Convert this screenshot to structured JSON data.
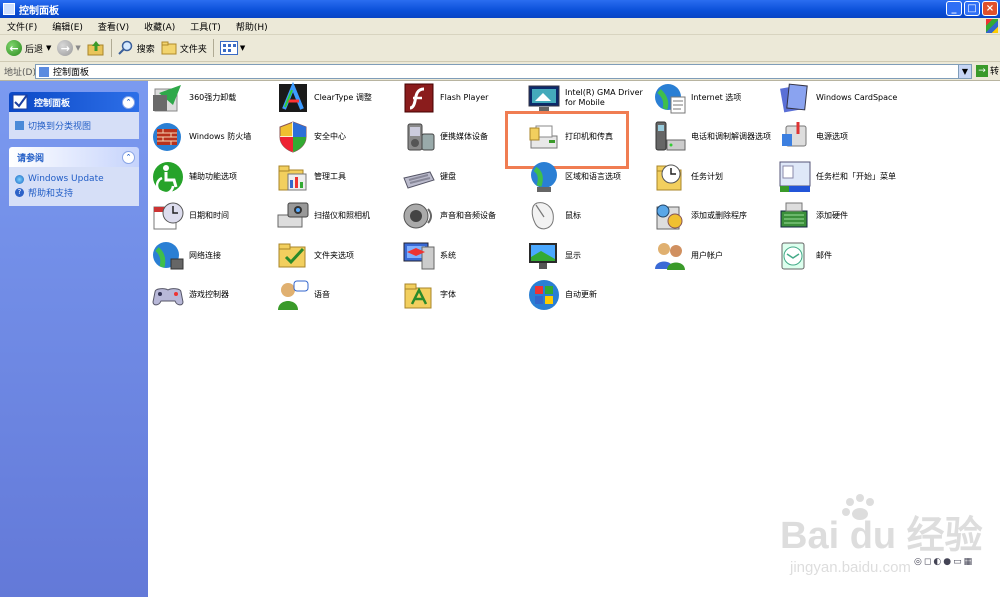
{
  "window": {
    "title": "控制面板"
  },
  "menu": [
    "文件(F)",
    "编辑(E)",
    "查看(V)",
    "收藏(A)",
    "工具(T)",
    "帮助(H)"
  ],
  "toolbar": {
    "back": "后退",
    "search": "搜索",
    "folders": "文件夹"
  },
  "address": {
    "label": "地址(D)",
    "value": "控制面板",
    "go": "转"
  },
  "sidebar": {
    "panel1": {
      "title": "控制面板",
      "link": "切换到分类视图"
    },
    "panel2": {
      "title": "请参阅",
      "links": [
        "Windows Update",
        "帮助和支持"
      ]
    }
  },
  "items": [
    {
      "label": "360强力卸载",
      "icon": "360-uninstall-icon"
    },
    {
      "label": "ClearType 调整",
      "icon": "cleartype-icon"
    },
    {
      "label": "Flash Player",
      "icon": "flash-icon"
    },
    {
      "label": "Intel(R) GMA Driver for Mobile",
      "icon": "intel-gma-icon"
    },
    {
      "label": "Internet 选项",
      "icon": "internet-options-icon"
    },
    {
      "label": "Windows CardSpace",
      "icon": "cardspace-icon"
    },
    {
      "label": "Windows 防火墙",
      "icon": "firewall-icon"
    },
    {
      "label": "安全中心",
      "icon": "security-center-icon"
    },
    {
      "label": "便携媒体设备",
      "icon": "portable-media-icon"
    },
    {
      "label": "打印机和传真",
      "icon": "printer-fax-icon"
    },
    {
      "label": "电话和调制解调器选项",
      "icon": "phone-modem-icon"
    },
    {
      "label": "电源选项",
      "icon": "power-options-icon"
    },
    {
      "label": "辅助功能选项",
      "icon": "accessibility-icon"
    },
    {
      "label": "管理工具",
      "icon": "admin-tools-icon"
    },
    {
      "label": "键盘",
      "icon": "keyboard-icon"
    },
    {
      "label": "区域和语言选项",
      "icon": "region-language-icon"
    },
    {
      "label": "任务计划",
      "icon": "scheduled-tasks-icon"
    },
    {
      "label": "任务栏和「开始」菜单",
      "icon": "taskbar-start-icon"
    },
    {
      "label": "日期和时间",
      "icon": "date-time-icon"
    },
    {
      "label": "扫描仪和照相机",
      "icon": "scanner-camera-icon"
    },
    {
      "label": "声音和音频设备",
      "icon": "sound-audio-icon"
    },
    {
      "label": "鼠标",
      "icon": "mouse-icon"
    },
    {
      "label": "添加或删除程序",
      "icon": "add-remove-programs-icon"
    },
    {
      "label": "添加硬件",
      "icon": "add-hardware-icon"
    },
    {
      "label": "网络连接",
      "icon": "network-connections-icon"
    },
    {
      "label": "文件夹选项",
      "icon": "folder-options-icon"
    },
    {
      "label": "系统",
      "icon": "system-icon"
    },
    {
      "label": "显示",
      "icon": "display-icon"
    },
    {
      "label": "用户帐户",
      "icon": "user-accounts-icon"
    },
    {
      "label": "邮件",
      "icon": "mail-icon"
    },
    {
      "label": "游戏控制器",
      "icon": "game-controllers-icon"
    },
    {
      "label": "语音",
      "icon": "speech-icon"
    },
    {
      "label": "字体",
      "icon": "fonts-icon"
    },
    {
      "label": "自动更新",
      "icon": "automatic-updates-icon"
    }
  ],
  "watermark": {
    "brand": "Bai du 经验",
    "url": "jingyan.baidu.com"
  }
}
